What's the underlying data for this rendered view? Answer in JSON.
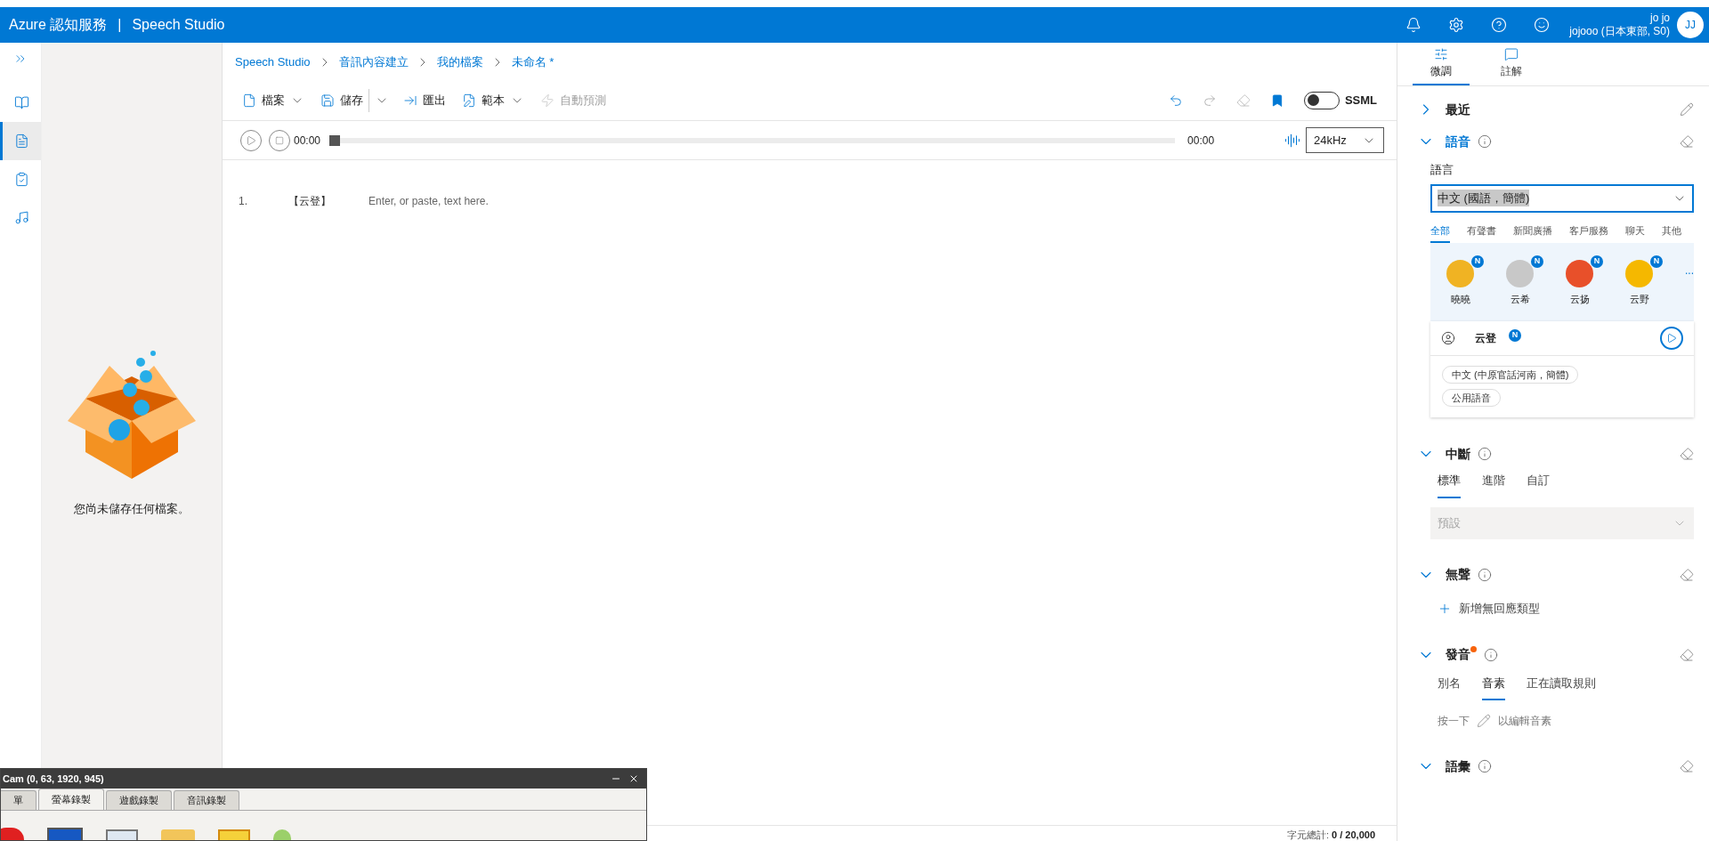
{
  "header": {
    "brand": "Azure 認知服務",
    "separator": "|",
    "product": "Speech Studio",
    "user_name": "jo jo",
    "user_detail": "jojooo (日本東部, S0)",
    "avatar_initials": "JJ"
  },
  "nav_rail": [
    {
      "selected": false
    },
    {
      "selected": true
    },
    {
      "selected": false
    },
    {
      "selected": false
    }
  ],
  "files_panel": {
    "empty_message": "您尚未儲存任何檔案。"
  },
  "breadcrumb": [
    "Speech Studio",
    "音訊內容建立",
    "我的檔案",
    "未命名 *"
  ],
  "toolbar": [
    {
      "label": "檔案",
      "kind": "menu",
      "disabled": false
    },
    {
      "label": "儲存",
      "kind": "split",
      "disabled": false
    },
    {
      "label": "匯出",
      "kind": "export",
      "disabled": false
    },
    {
      "label": "範本",
      "kind": "template",
      "disabled": false
    },
    {
      "label": "自動預測",
      "kind": "auto",
      "disabled": true
    }
  ],
  "ssml": {
    "label": "SSML",
    "on": false
  },
  "player": {
    "start_time": "00:00",
    "end_time": "00:00",
    "level": 0,
    "sample_rate": "24kHz"
  },
  "editor": {
    "lines": [
      {
        "number": "1.",
        "voice": "【云登】",
        "placeholder": "Enter, or paste, text here."
      }
    ]
  },
  "status_bar": {
    "label": "字元總計:",
    "count": "0 / 20,000"
  },
  "right_panel": {
    "tabs": [
      {
        "label": "微調",
        "selected": true
      },
      {
        "label": "註解",
        "selected": false
      }
    ],
    "recent": {
      "title": "最近",
      "expanded": false
    },
    "voice": {
      "title": "語音",
      "expanded": true,
      "language_label": "語言",
      "language_value": "中文 (國語，簡體)",
      "text_selected": true,
      "categories": [
        {
          "label": "全部",
          "selected": true
        },
        {
          "label": "有聲書",
          "selected": false
        },
        {
          "label": "新聞廣播",
          "selected": false
        },
        {
          "label": "客戶服務",
          "selected": false
        },
        {
          "label": "聊天",
          "selected": false
        },
        {
          "label": "其他",
          "selected": false
        }
      ],
      "voices": [
        {
          "name": "曉曉",
          "badge": "N",
          "color": "#f0b323"
        },
        {
          "name": "云希",
          "badge": "N",
          "color": "#c8c8c8"
        },
        {
          "name": "云扬",
          "badge": "N",
          "color": "#e8502a"
        },
        {
          "name": "云野",
          "badge": "N",
          "color": "#f5b800"
        }
      ],
      "more": "...",
      "selected_voice": {
        "name": "云登",
        "badge": "N",
        "tags": [
          "中文 (中原官話河南，簡體)",
          "公用語音"
        ]
      }
    },
    "break": {
      "title": "中斷",
      "expanded": true,
      "tabs": [
        {
          "label": "標準",
          "selected": true
        },
        {
          "label": "進階",
          "selected": false
        },
        {
          "label": "自訂",
          "selected": false
        }
      ],
      "select_placeholder": "預設",
      "disabled": true
    },
    "silence": {
      "title": "無聲",
      "expanded": true,
      "add_label": "新增無回應類型"
    },
    "pronunciation": {
      "title": "發音",
      "expanded": true,
      "modified": true,
      "tabs": [
        {
          "label": "別名",
          "selected": false
        },
        {
          "label": "音素",
          "selected": true
        },
        {
          "label": "正在讀取規則",
          "selected": false
        }
      ],
      "hint_before": "按一下",
      "hint_after": "以編輯音素"
    },
    "vocabulary": {
      "title": "語彙",
      "expanded": true
    }
  },
  "recorder_window": {
    "title": "Cam (0, 63, 1920, 945)",
    "tabs": [
      {
        "label": "單",
        "selected": false
      },
      {
        "label": "螢幕錄製",
        "selected": true
      },
      {
        "label": "遊戲錄製",
        "selected": false
      },
      {
        "label": "音訊錄製",
        "selected": false
      }
    ]
  }
}
